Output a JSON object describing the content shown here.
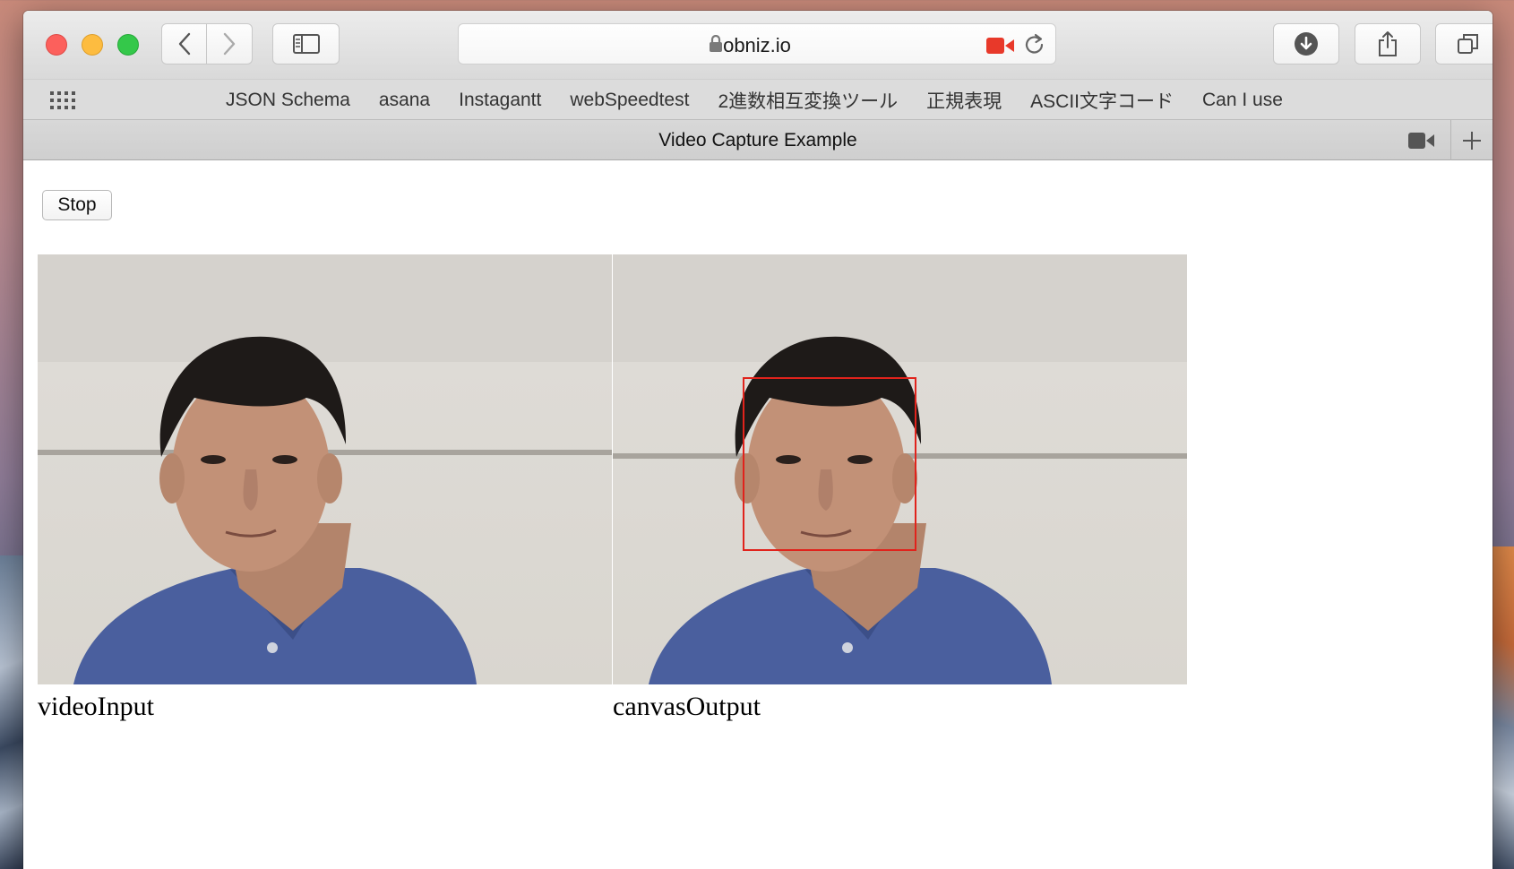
{
  "browser": {
    "url": "obniz.io",
    "bookmarks": [
      "JSON Schema",
      "asana",
      "Instagantt",
      "webSpeedtest",
      "2進数相互変換ツール",
      "正規表現",
      "ASCII文字コード",
      "Can I use"
    ],
    "tab_title": "Video Capture Example",
    "icons": {
      "back": "chevron-left-icon",
      "forward": "chevron-right-icon",
      "sidebar": "sidebar-icon",
      "lock": "lock-icon",
      "camera": "camera-recording-icon",
      "reload": "reload-icon",
      "download": "download-icon",
      "share": "share-icon",
      "tabs": "tabs-overview-icon",
      "favorites": "grid-icon",
      "new_tab": "plus-icon"
    },
    "colors": {
      "camera_active": "#e8392a",
      "face_box": "#e0231c"
    }
  },
  "page": {
    "stop_label": "Stop",
    "video_caption": "videoInput",
    "canvas_caption": "canvasOutput"
  }
}
